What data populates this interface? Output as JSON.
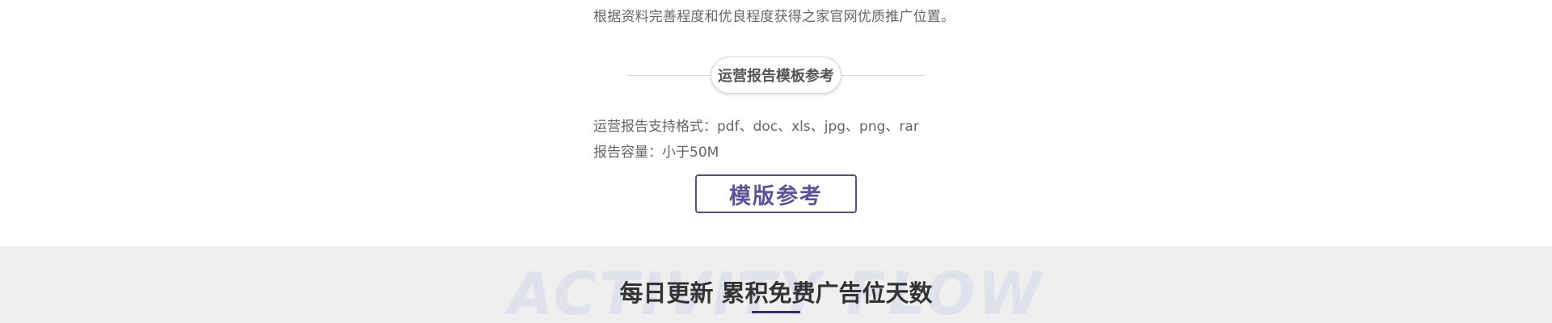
{
  "intro": {
    "text": "根据资料完善程度和优良程度获得之家官网优质推广位置。"
  },
  "report_section": {
    "heading": "运营报告模板参考",
    "formats_line": "运营报告支持格式：pdf、doc、xls、jpg、png、rar",
    "size_line": "报告容量：小于50M",
    "template_button_label": "模版参考"
  },
  "activity_section": {
    "watermark": "ACTIVITY FLOW",
    "title": "每日更新 累积免费广告位天数"
  },
  "colors": {
    "accent": "#574e8e",
    "underline": "#3b2a7d",
    "band_background": "#efefef",
    "watermark": "#dfe1ec"
  }
}
